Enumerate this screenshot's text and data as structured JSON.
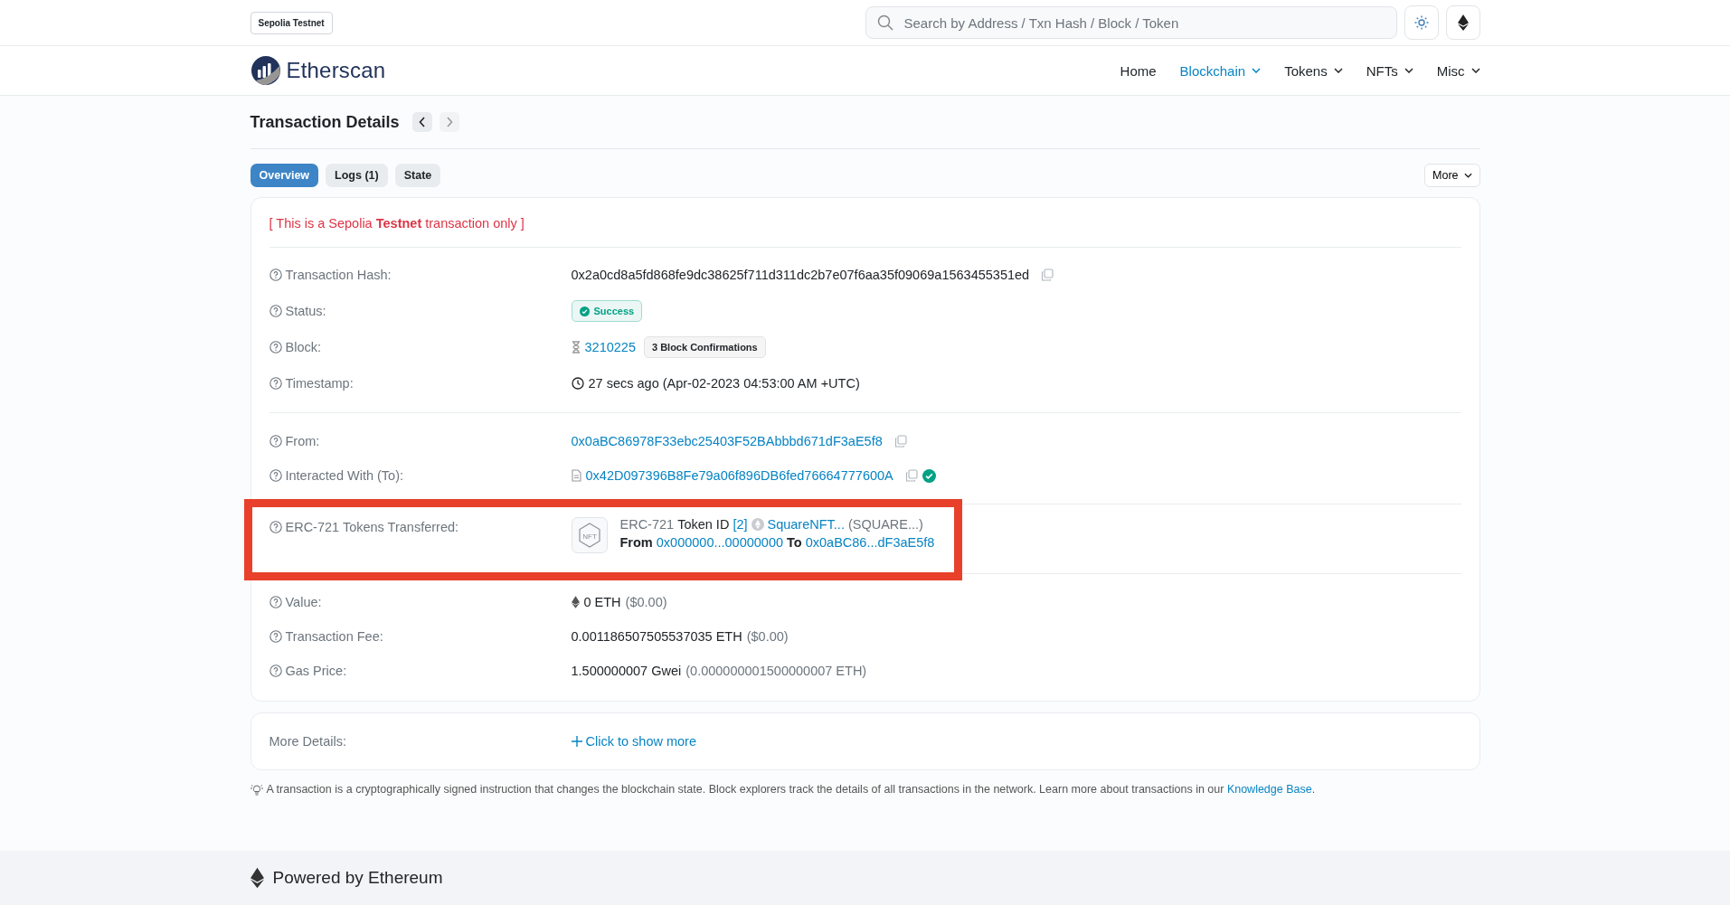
{
  "network_badge": "Sepolia Testnet",
  "search": {
    "placeholder": "Search by Address / Txn Hash / Block / Token"
  },
  "logo": {
    "text": "Etherscan"
  },
  "nav": [
    {
      "label": "Home",
      "selected": false,
      "dropdown": false
    },
    {
      "label": "Blockchain",
      "selected": true,
      "dropdown": true
    },
    {
      "label": "Tokens",
      "selected": false,
      "dropdown": true
    },
    {
      "label": "NFTs",
      "selected": false,
      "dropdown": true
    },
    {
      "label": "Misc",
      "selected": false,
      "dropdown": true
    }
  ],
  "page_title": "Transaction Details",
  "tabs": [
    {
      "label": "Overview",
      "selected": true
    },
    {
      "label": "Logs (1)",
      "selected": false
    },
    {
      "label": "State",
      "selected": false
    }
  ],
  "more_button": "More",
  "testnet_notice": "[ This is a Sepolia **Testnet** transaction only ]",
  "sections": [
    {
      "highlighted": false,
      "rows": [
        {
          "kind": "hash",
          "label": "Transaction Hash:",
          "value": "0x2a0cd8a5fd868fe9dc38625f711d311dc2b7e07f6aa35f09069a1563455351ed"
        },
        {
          "kind": "status",
          "label": "Status:",
          "badge": "Success"
        },
        {
          "kind": "block",
          "label": "Block:",
          "number": "3210225",
          "confirmations": "3 Block Confirmations"
        },
        {
          "kind": "timestamp",
          "label": "Timestamp:",
          "value": "27 secs ago (Apr-02-2023 04:53:00 AM +UTC)"
        }
      ]
    },
    {
      "highlighted": false,
      "rows": [
        {
          "kind": "address",
          "label": "From:",
          "value": "0x0aBC86978F33ebc25403F52BAbbbd671dF3aE5f8",
          "contract": false,
          "verified": false
        },
        {
          "kind": "address",
          "label": "Interacted With (To):",
          "value": "0x42D097396B8Fe79a06f896DB6fed76664777600A",
          "contract": true,
          "verified": true
        }
      ]
    },
    {
      "highlighted": true,
      "rows": [
        {
          "kind": "nft_transfer",
          "label": "ERC-721 Tokens Transferred:",
          "icon_text": "NFT",
          "standard": "ERC-721",
          "token_id_label": "Token ID",
          "token_id": "[2]",
          "token_name": "SquareNFT...",
          "token_symbol": "(SQUARE...)",
          "from_label": "From",
          "from": "0x000000...00000000",
          "to_label": "To",
          "to": "0x0aBC86...dF3aE5f8"
        }
      ]
    },
    {
      "highlighted": false,
      "rows": [
        {
          "kind": "amount",
          "label": "Value:",
          "amount": "0 ETH",
          "usd": "($0.00)",
          "eth_icon": true
        },
        {
          "kind": "amount",
          "label": "Transaction Fee:",
          "amount": "0.001186507505537035 ETH",
          "usd": "($0.00)",
          "eth_icon": false
        },
        {
          "kind": "amount",
          "label": "Gas Price:",
          "amount": "1.500000007 Gwei",
          "usd": "(0.000000001500000007 ETH)",
          "eth_icon": false
        }
      ]
    }
  ],
  "more_details": {
    "label": "More Details:",
    "link": "Click to show more"
  },
  "note": {
    "text": "A transaction is a cryptographically signed instruction that changes the blockchain state. Block explorers track the details of all transactions in the network. Learn more about transactions in our ",
    "link": "Knowledge Base",
    "after": "."
  },
  "footer": {
    "text": "Powered by Ethereum"
  }
}
